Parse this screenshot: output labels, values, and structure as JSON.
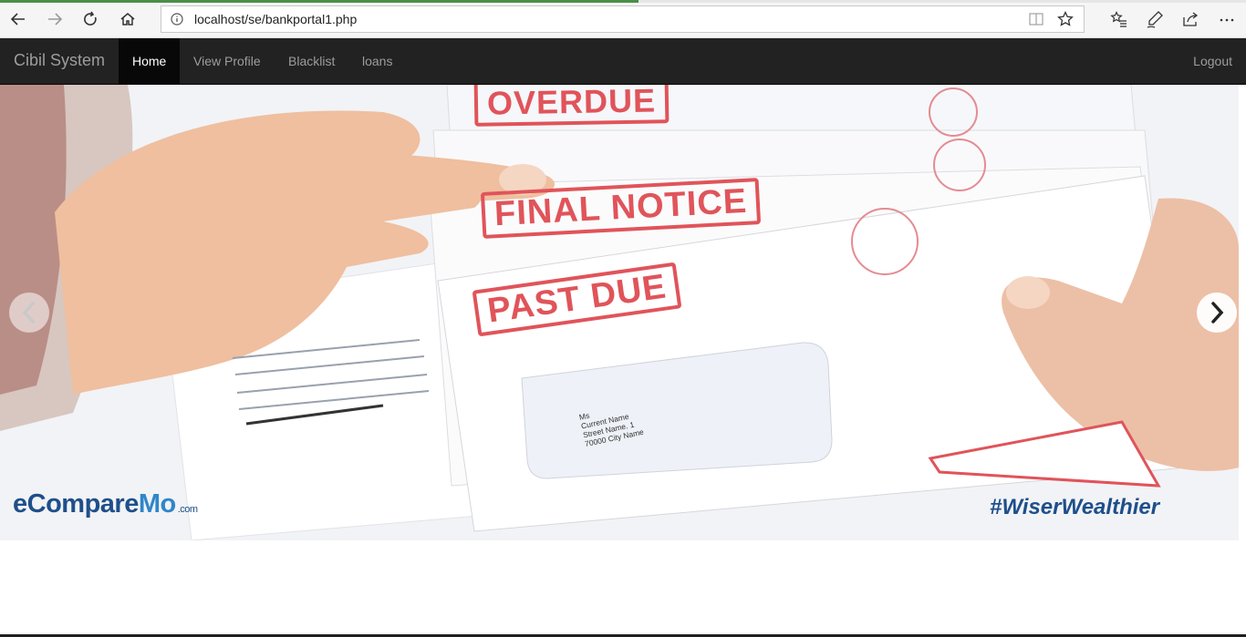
{
  "browser": {
    "url": "localhost/se/bankportal1.php",
    "icons": [
      "back-icon",
      "forward-icon",
      "refresh-icon",
      "home-icon",
      "info-icon",
      "reading-view-icon",
      "favorite-star-icon",
      "favorites-list-icon",
      "pen-icon",
      "share-icon",
      "more-icon"
    ]
  },
  "navbar": {
    "brand": "Cibil System",
    "items": [
      {
        "label": "Home",
        "active": true
      },
      {
        "label": "View Profile",
        "active": false
      },
      {
        "label": "Blacklist",
        "active": false
      },
      {
        "label": "loans",
        "active": false
      }
    ],
    "logout": "Logout"
  },
  "carousel": {
    "slide": {
      "stamps": [
        "OVERDUE",
        "FINAL NOTICE",
        "PAST DUE"
      ],
      "envelope_address": [
        "Ms",
        "Current Name",
        "Street Name. 1",
        "70000 City Name"
      ],
      "logo": {
        "part1": "eCompare",
        "part2": "Mo",
        "suffix": ".com"
      },
      "hashtag": "#WiserWealthier"
    },
    "controls": {
      "prev": "chevron-left-icon",
      "next": "chevron-right-icon"
    }
  },
  "colors": {
    "navbar_bg": "#222222",
    "navbar_active": "#080808",
    "nav_text": "#9d9d9d",
    "stamp_red": "#e0545a",
    "logo_blue": "#1e4f8a"
  }
}
